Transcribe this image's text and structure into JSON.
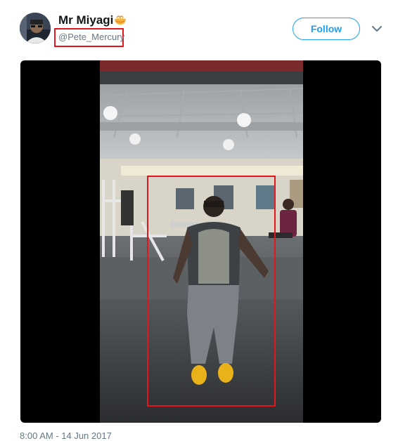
{
  "user": {
    "display_name": "Mr Miyagi",
    "name_emoji": "noodle-bowl-emoji",
    "handle": "@Pete_Mercury",
    "avatar": "profile-photo"
  },
  "actions": {
    "follow_label": "Follow",
    "more_icon": "chevron-down-icon"
  },
  "media": {
    "type": "video-still",
    "scene": "gym-dancer",
    "highlight_color": "#e3161d"
  },
  "footer": {
    "timestamp": "8:00 AM - 14 Jun 2017"
  },
  "colors": {
    "accent": "#1da1f2",
    "name": "#14171a",
    "secondary_text": "#657786",
    "annotation": "#e3161d"
  }
}
